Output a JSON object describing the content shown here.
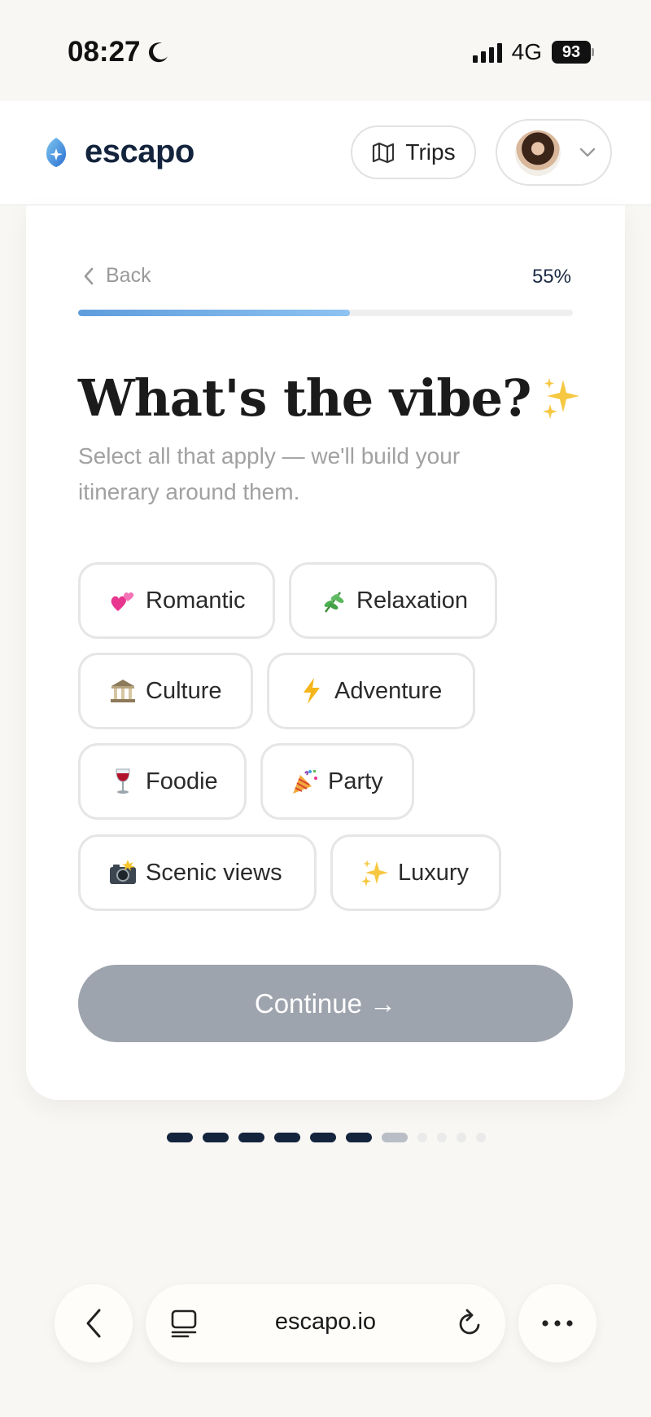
{
  "status_bar": {
    "time": "08:27",
    "network": "4G",
    "battery": "93",
    "icons": [
      "moon-icon",
      "signal-icon",
      "battery-icon"
    ]
  },
  "header": {
    "brand_name": "escapo",
    "trips_label": "Trips",
    "icons": [
      "escapo-logo",
      "map-icon",
      "avatar",
      "chevron-down-icon"
    ]
  },
  "card": {
    "back_label": "Back",
    "progress_label": "55%",
    "progress_fraction": 0.55,
    "title": "What's the vibe?",
    "subtitle": "Select all that apply — we'll build your itinerary around them.",
    "chips": [
      {
        "label": "Romantic",
        "icon": "two-hearts-emoji"
      },
      {
        "label": "Relaxation",
        "icon": "herb-emoji"
      },
      {
        "label": "Culture",
        "icon": "classical-building-emoji"
      },
      {
        "label": "Adventure",
        "icon": "lightning-emoji"
      },
      {
        "label": "Foodie",
        "icon": "wine-glass-emoji"
      },
      {
        "label": "Party",
        "icon": "party-popper-emoji"
      },
      {
        "label": "Scenic views",
        "icon": "camera-flash-emoji"
      },
      {
        "label": "Luxury",
        "icon": "sparkles-emoji"
      }
    ],
    "continue_label": "Continue →"
  },
  "steps": {
    "total": 11,
    "completed": 6,
    "current": 7
  },
  "browser": {
    "url": "escapo.io",
    "icons": [
      "back-chevron-icon",
      "tabs-icon",
      "reload-icon",
      "more-icon"
    ]
  },
  "colors": {
    "brand_navy": "#14243d",
    "progress_blue": "#5e9cdc",
    "disabled_button": "#9ea4ad",
    "background": "#f8f7f4"
  }
}
